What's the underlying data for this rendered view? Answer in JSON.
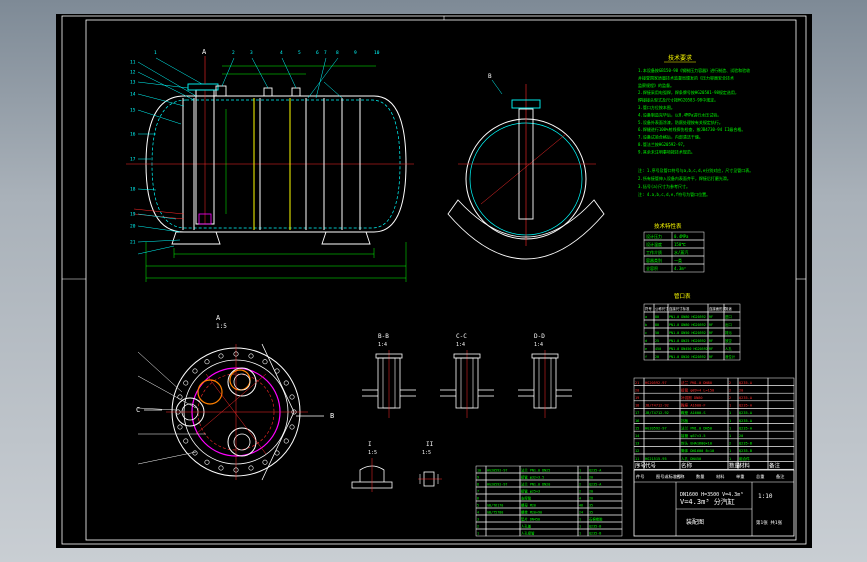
{
  "sheet": {
    "background": "#000000",
    "colors": {
      "cyan": "#00ffff",
      "white": "#ffffff",
      "red": "#ff2a2a",
      "green": "#00ff00",
      "yellow": "#ffff00",
      "magenta": "#ff00ff",
      "orange": "#ff8000"
    }
  },
  "main_view": {
    "marker_a": "A",
    "top_tags": [
      "1",
      "2",
      "3",
      "4",
      "5",
      "6",
      "7",
      "8",
      "9",
      "10"
    ],
    "left_tags": [
      "11",
      "12",
      "13",
      "14",
      "15",
      "16",
      "17",
      "18",
      "19",
      "20",
      "21"
    ]
  },
  "end_view_label": "B",
  "detail_a": {
    "title": "A",
    "scale": "1:5"
  },
  "section_views": [
    {
      "title": "B-B",
      "scale": "1:4"
    },
    {
      "title": "C-C",
      "scale": "1:4"
    },
    {
      "title": "D-D",
      "scale": "1:4"
    }
  ],
  "small_details": [
    {
      "title": "I",
      "scale": "1:5"
    },
    {
      "title": "II",
      "scale": "1:5"
    }
  ],
  "notes": {
    "title": "技术要求",
    "lines": [
      "1.本设备按GB150-98《钢制压力容器》进行制造、试验和验收",
      "  并接受国家质量技术监督局颁发的《压力容器安全技术",
      "  监察规程》的监督。",
      "2.焊接采用电弧焊，焊条牌号按HG20581-98规定选用，",
      "  焊接接头型式及尺寸按HG20583-98中规定。",
      "3.管口方位按本图。",
      "4.设备制造完毕后，以0.4MPa进行水压试验。",
      "5.设备外表面涂漆，防腐处理按有关规定执行。",
      "6.焊缝进行100%射线探伤检查，按JB4730-94 II级合格。",
      "7.设备试验合格后，内部清洁干燥。",
      "8.管法兰按HG20592-97。",
      "9.其余未注明事项按技术规范。"
    ],
    "lines2": [
      "注: 1.序号及管口符号与a,b,c,d,e分别对应，尺寸见管口表。",
      "    2.所有接管伸入设备内表面齐平，焊接后打磨光滑。",
      "    3.括号(a)尺寸为参考尺寸。",
      "注: 4.a,b,c,d,e,f符号为管口位置。"
    ]
  },
  "tech_table": {
    "title": "技术特性表",
    "rows": [
      [
        "设计压力",
        "0.4MPa"
      ],
      [
        "设计温度",
        "150℃"
      ],
      [
        "工作介质",
        "水/蒸汽"
      ],
      [
        "容器类别",
        "一类"
      ],
      [
        "全容积",
        "4.3m³"
      ]
    ]
  },
  "nozzle_table": {
    "title": "管口表",
    "headers": [
      "符号",
      "公称尺寸",
      "连接尺寸标准",
      "连接面形式",
      "用途"
    ],
    "rows": [
      [
        "a",
        "80",
        "PN1.0 DN80 HG20592",
        "RF",
        "进口"
      ],
      [
        "b",
        "80",
        "PN1.0 DN80 HG20592",
        "RF",
        "出口"
      ],
      [
        "c",
        "50",
        "PN1.0 DN50 HG20592",
        "RF",
        "排污"
      ],
      [
        "d",
        "25",
        "PN1.0 DN25 HG20592",
        "RF",
        "放空"
      ],
      [
        "e",
        "450",
        "PN1.0 DN450 HG20592",
        "RF",
        "人孔"
      ],
      [
        "f",
        "20",
        "PN1.0 DN20 HG20592",
        "RF",
        "液位计"
      ]
    ]
  },
  "bom_right": {
    "rows": [
      [
        "21",
        "HG20592-97",
        "法兰 PN1.0 DN80",
        "2",
        "Q235-A",
        ""
      ],
      [
        "20",
        "",
        "接管 φ89×4 L=150",
        "2",
        "20",
        ""
      ],
      [
        "19",
        "",
        "补强圈 DN80",
        "2",
        "Q235-A",
        ""
      ],
      [
        "18",
        "JB/T4712-92",
        "鞍座 A1600-F",
        "1",
        "Q235-A",
        ""
      ],
      [
        "17",
        "JB/T4712-92",
        "鞍座 A1600-S",
        "1",
        "Q235-A",
        ""
      ],
      [
        "16",
        "",
        "挡板",
        "1",
        "Q235-A",
        ""
      ],
      [
        "15",
        "HG20592-97",
        "法兰 PN1.0 DN50",
        "1",
        "Q235-A",
        ""
      ],
      [
        "14",
        "",
        "接管 φ57×3.5",
        "1",
        "20",
        ""
      ],
      [
        "13",
        "",
        "封头 EHA1600×10",
        "2",
        "Q235-B",
        ""
      ],
      [
        "12",
        "",
        "筒体 DN1600 δ=10",
        "1",
        "Q235-B",
        ""
      ],
      [
        "11",
        "HG21515-95",
        "人孔 DN450",
        "1",
        "组合件",
        ""
      ]
    ],
    "header": [
      "序号",
      "代号",
      "名称",
      "数量",
      "材料",
      "备注"
    ]
  },
  "title_block": {
    "labels": [
      "件号",
      "图号或标准号",
      "名称",
      "数量",
      "材料",
      "单重",
      "总重",
      "备注"
    ],
    "drawing_title": "V=4.3m³ 分汽缸",
    "subtitle": "DN1600 H=3500 V=4.3m³",
    "drawing_no": "装配图",
    "scale": "1:10",
    "sheet": "第1张 共1张"
  },
  "bom_left": {
    "rows": [
      [
        "10",
        "HG20592-97",
        "法兰 PN1.0 DN25",
        "1",
        "Q235-A"
      ],
      [
        "9",
        "",
        "接管 φ32×3.5",
        "1",
        "20"
      ],
      [
        "8",
        "HG20592-97",
        "法兰 PN1.0 DN20",
        "2",
        "Q235-A"
      ],
      [
        "7",
        "",
        "接管 φ25×3",
        "2",
        "20"
      ],
      [
        "6",
        "",
        "支撑管",
        "4",
        "20"
      ],
      [
        "5",
        "GB/T6170",
        "螺母 M20",
        "48",
        "35"
      ],
      [
        "4",
        "GB/T5780",
        "螺栓 M20×90",
        "24",
        "35"
      ],
      [
        "3",
        "",
        "垫片 DN450",
        "1",
        "石棉橡胶"
      ],
      [
        "2",
        "",
        "人孔盖",
        "1",
        "Q235-B"
      ],
      [
        "1",
        "",
        "人孔接管",
        "1",
        "Q235-B"
      ]
    ]
  }
}
